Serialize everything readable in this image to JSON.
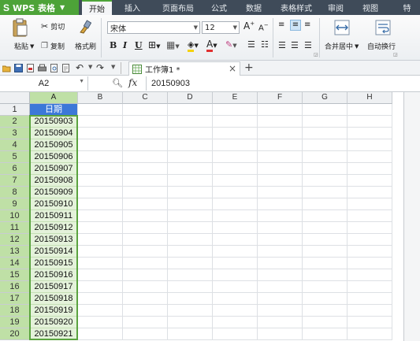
{
  "menubar": {
    "app_title": "WPS 表格",
    "tabs": [
      "开始",
      "插入",
      "页面布局",
      "公式",
      "数据",
      "表格样式",
      "审阅",
      "视图",
      "特"
    ]
  },
  "ribbon": {
    "paste_label": "粘贴",
    "cut_label": "剪切",
    "copy_label": "复制",
    "format_painter_label": "格式刷",
    "font_name": "宋体",
    "font_size": "12",
    "bold": "B",
    "italic": "I",
    "underline": "U",
    "merge_center_label": "合并居中",
    "wrap_text_label": "自动换行"
  },
  "quickbar": {
    "document_tab": "工作簿1 *",
    "close_glyph": "×",
    "new_tab_glyph": "+"
  },
  "formula_bar": {
    "name_box": "A2",
    "fx": "fx",
    "content": "20150903"
  },
  "sheet": {
    "columns": [
      "A",
      "B",
      "C",
      "D",
      "E",
      "F",
      "G",
      "H"
    ],
    "rows": [
      {
        "num": "1",
        "a": "日期"
      },
      {
        "num": "2",
        "a": "20150903"
      },
      {
        "num": "3",
        "a": "20150904"
      },
      {
        "num": "4",
        "a": "20150905"
      },
      {
        "num": "5",
        "a": "20150906"
      },
      {
        "num": "6",
        "a": "20150907"
      },
      {
        "num": "7",
        "a": "20150908"
      },
      {
        "num": "8",
        "a": "20150909"
      },
      {
        "num": "9",
        "a": "20150910"
      },
      {
        "num": "10",
        "a": "20150911"
      },
      {
        "num": "11",
        "a": "20150912"
      },
      {
        "num": "12",
        "a": "20150913"
      },
      {
        "num": "13",
        "a": "20150914"
      },
      {
        "num": "14",
        "a": "20150915"
      },
      {
        "num": "15",
        "a": "20150916"
      },
      {
        "num": "16",
        "a": "20150917"
      },
      {
        "num": "17",
        "a": "20150918"
      },
      {
        "num": "18",
        "a": "20150919"
      },
      {
        "num": "19",
        "a": "20150920"
      },
      {
        "num": "20",
        "a": "20150921"
      }
    ]
  },
  "colors": {
    "accent_green": "#4da338",
    "header_blue": "#3c78d8",
    "selection_fill": "#e4f2da"
  }
}
